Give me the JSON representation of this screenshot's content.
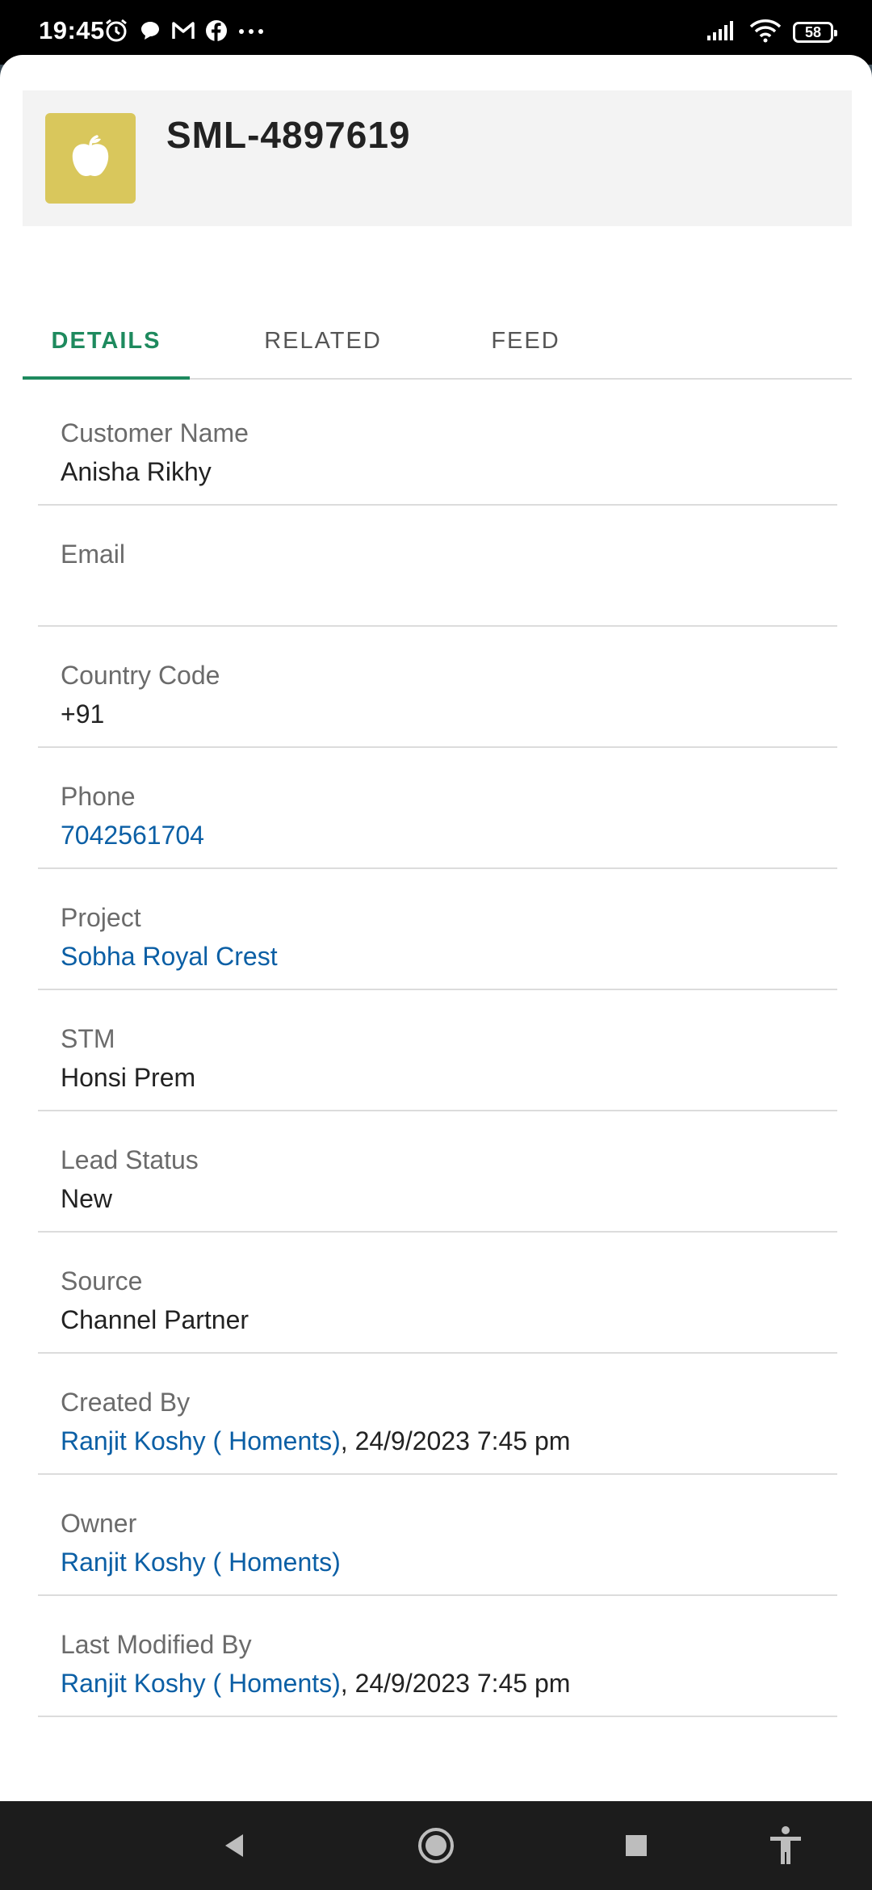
{
  "status_bar": {
    "time": "19:45",
    "battery": "58",
    "left_icons": [
      "alarm-icon",
      "chat-icon",
      "gmail-icon",
      "facebook-icon",
      "more-dots-icon"
    ],
    "right_icons": [
      "signal-icon",
      "wifi-icon",
      "battery-icon"
    ]
  },
  "header": {
    "title": "SML-4897619",
    "avatar_icon": "apple-icon",
    "avatar_color": "#d9c75c"
  },
  "tabs": [
    {
      "label": "DETAILS",
      "active": true
    },
    {
      "label": "RELATED",
      "active": false
    },
    {
      "label": "FEED",
      "active": false
    }
  ],
  "fields": [
    {
      "label": "Customer Name",
      "value": "Anisha Rikhy"
    },
    {
      "label": "Email",
      "value": ""
    },
    {
      "label": "Country Code",
      "value": "+91"
    },
    {
      "label": "Phone",
      "value": "7042561704"
    },
    {
      "label": "Project",
      "value": "Sobha Royal Crest"
    },
    {
      "label": "STM",
      "value": "Honsi Prem"
    },
    {
      "label": "Lead Status",
      "value": "New"
    },
    {
      "label": "Source",
      "value": "Channel Partner"
    },
    {
      "label": "Created By",
      "value_link": "Ranjit Koshy ( Homents)",
      "value_suffix": ", 24/9/2023 7:45 pm"
    },
    {
      "label": "Owner",
      "value_link": "Ranjit Koshy ( Homents)"
    },
    {
      "label": "Last Modified By",
      "value_link": "Ranjit Koshy ( Homents)",
      "value_suffix": ", 24/9/2023 7:45 pm"
    }
  ],
  "colors": {
    "accent": "#1e8a5e",
    "link": "#0b5fa5"
  },
  "nav_bar": [
    "back-icon",
    "home-icon",
    "recents-icon",
    "accessibility-icon"
  ]
}
